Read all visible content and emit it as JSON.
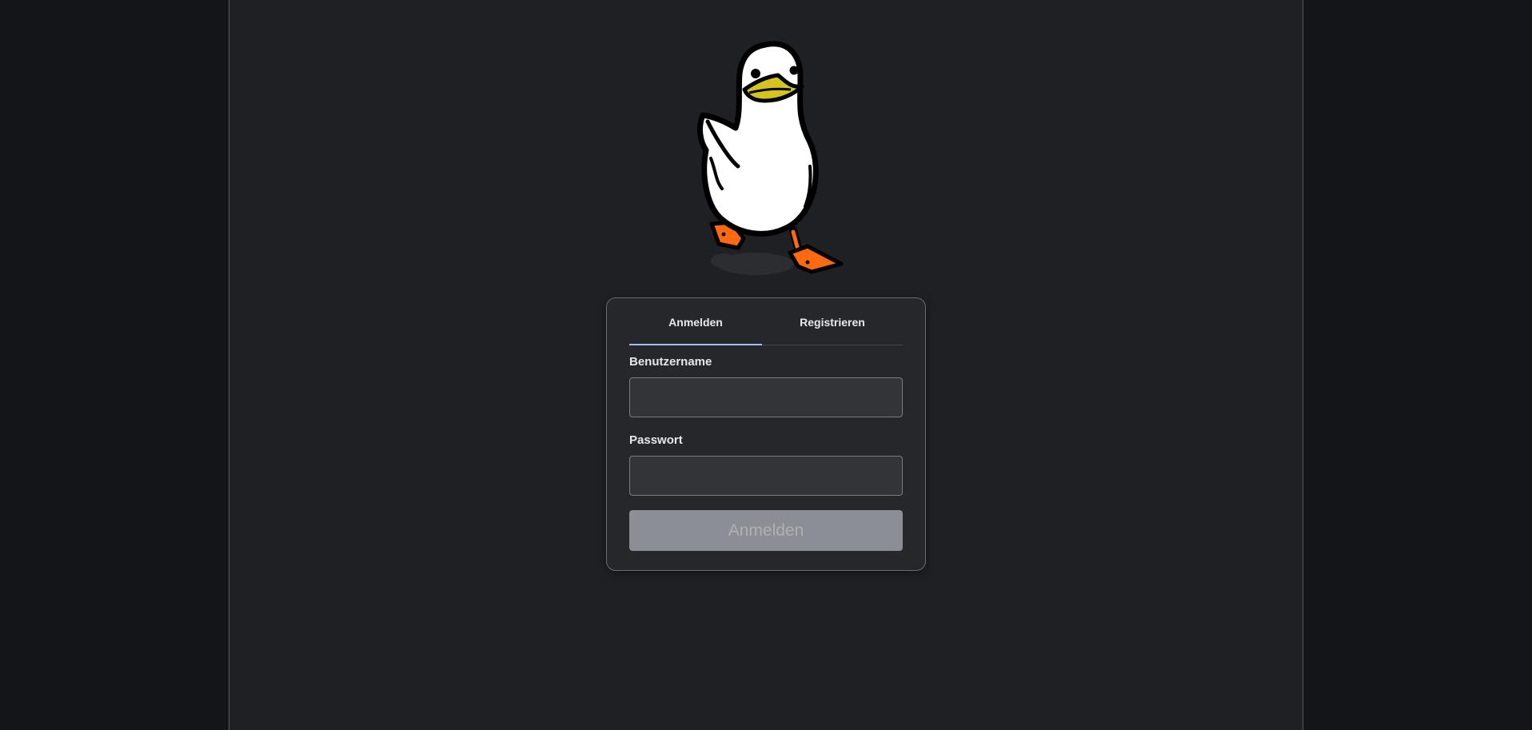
{
  "tabs": {
    "login_label": "Anmelden",
    "register_label": "Registrieren",
    "active": "login"
  },
  "form": {
    "username_label": "Benutzername",
    "username_value": "",
    "password_label": "Passwort",
    "password_value": "",
    "submit_label": "Anmelden",
    "submit_enabled": false
  },
  "icons": {
    "mascot": "duck-mascot-icon"
  },
  "colors": {
    "background": "#131519",
    "panel": "#1f2023",
    "card": "#26272b",
    "tab_indicator": "#a8b8f0",
    "button_disabled": "#8c8e95",
    "duck_beak": "#d4c41c",
    "duck_feet": "#ff6a10"
  }
}
